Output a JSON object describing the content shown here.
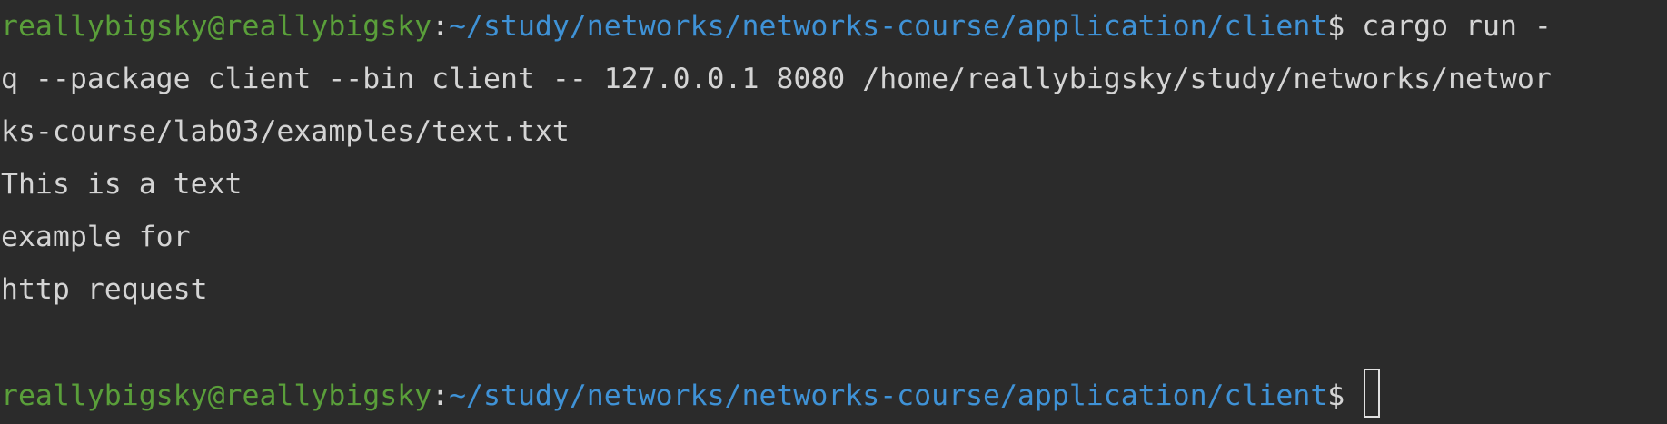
{
  "prompt": {
    "user_host": "reallybigsky@reallybigsky",
    "separator": ":",
    "path": "~/study/networks/networks-course/application/client",
    "dollar": "$"
  },
  "lines": {
    "cmd_part1": " cargo run -",
    "cmd_part2": "q --package client --bin client -- 127.0.0.1 8080 /home/reallybigsky/study/networks/networ",
    "cmd_part3": "ks-course/lab03/examples/text.txt",
    "out1": "This is a text",
    "out2": "example for",
    "out3": "http request",
    "blank": ""
  },
  "colors": {
    "background": "#2b2b2b",
    "user_host": "#5a9f3a",
    "path": "#3f92d6",
    "text": "#d4d4d4"
  },
  "icons": {
    "cursor": "block-cursor-icon"
  }
}
